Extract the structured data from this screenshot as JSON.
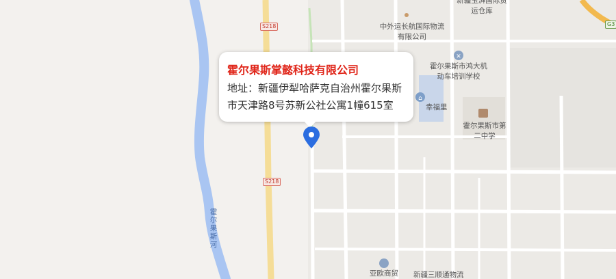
{
  "popup": {
    "company_name": "霍尔果斯掌懿科技有限公司",
    "address": "地址：新疆伊犁哈萨克自治州霍尔果斯市天津路8号苏新公社公寓1幢615室"
  },
  "road_badges": {
    "upper": "S218",
    "lower": "S218",
    "corner": "G3"
  },
  "labels": {
    "top_partial": "新疆玉湃国际",
    "warehouse": "新疆玉湃国际货运仓库",
    "logistics": "中外运长航国际物流有限公司",
    "driving_school": "霍尔果斯市鸿大机动车培训学校",
    "residence": "幸福里",
    "middle_school": "霍尔果斯市第二中学",
    "river": "霍尔果斯河",
    "mall": "亚欧商贸",
    "bottom_right": "新疆三顺通物流"
  },
  "colors": {
    "river": "#a9c5f2",
    "highway": "#f5dd97",
    "marker": "#2b6de0",
    "title_red": "#e0261a"
  }
}
